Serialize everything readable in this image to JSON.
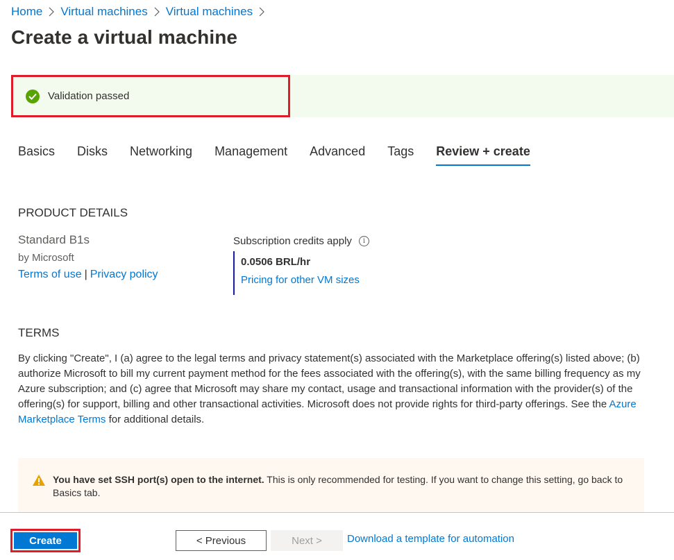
{
  "breadcrumb": {
    "items": [
      "Home",
      "Virtual machines",
      "Virtual machines"
    ]
  },
  "page": {
    "title": "Create a virtual machine"
  },
  "validation": {
    "text": "Validation passed",
    "color": "#57a300"
  },
  "tabs": [
    {
      "label": "Basics",
      "active": false
    },
    {
      "label": "Disks",
      "active": false
    },
    {
      "label": "Networking",
      "active": false
    },
    {
      "label": "Management",
      "active": false
    },
    {
      "label": "Advanced",
      "active": false
    },
    {
      "label": "Tags",
      "active": false
    },
    {
      "label": "Review + create",
      "active": true
    }
  ],
  "product": {
    "heading": "PRODUCT DETAILS",
    "name": "Standard B1s",
    "publisher": "by Microsoft",
    "terms_link": "Terms of use",
    "separator": "|",
    "privacy_link": "Privacy policy",
    "credits_label": "Subscription credits apply",
    "price": "0.0506 BRL/hr",
    "pricing_link": "Pricing for other VM sizes"
  },
  "terms": {
    "heading": "TERMS",
    "body_before_link": "By clicking \"Create\", I (a) agree to the legal terms and privacy statement(s) associated with the Marketplace offering(s) listed above; (b) authorize Microsoft to bill my current payment method for the fees associated with the offering(s), with the same billing frequency as my Azure subscription; and (c) agree that Microsoft may share my contact, usage and transactional information with the provider(s) of the offering(s) for support, billing and other transactional activities. Microsoft does not provide rights for third-party offerings. See the ",
    "link_text": "Azure Marketplace Terms",
    "body_after_link": " for additional details."
  },
  "warning": {
    "bold_text": "You have set SSH port(s) open to the internet.",
    "text": "  This is only recommended for testing.  If you want to change this setting, go back to Basics tab."
  },
  "footer": {
    "create_label": "Create",
    "previous_label": "< Previous",
    "next_label": "Next >",
    "template_link": "Download a template for automation"
  },
  "colors": {
    "accent": "#0078d4",
    "highlight_border": "#e01c2a",
    "warning": "#e8a100"
  }
}
